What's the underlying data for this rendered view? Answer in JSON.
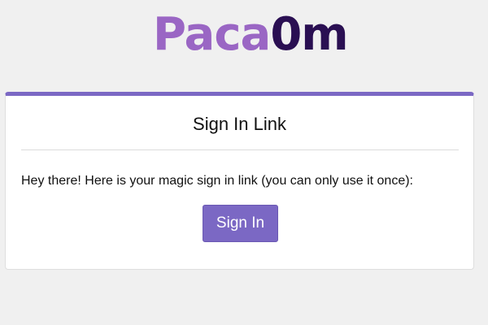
{
  "logo": {
    "part1": "Paca",
    "part2": "0m"
  },
  "card": {
    "title": "Sign In Link",
    "message": "Hey there! Here is your magic sign in link (you can only use it once):",
    "button_label": "Sign In"
  },
  "colors": {
    "accent": "#7b68c4",
    "logo_light": "#9a66c4",
    "logo_dark": "#2a0f52",
    "background": "#f0f0f0"
  }
}
